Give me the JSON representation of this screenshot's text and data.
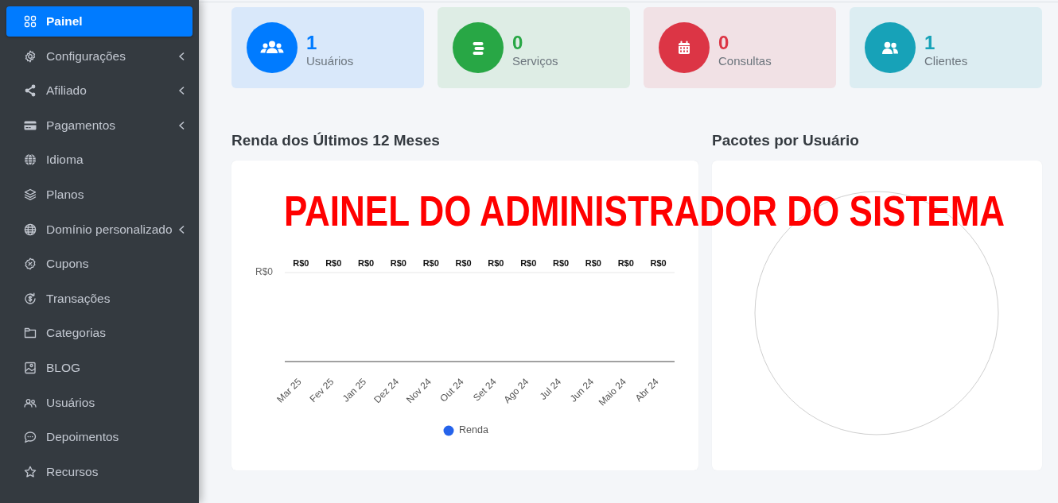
{
  "sidebar": {
    "items": [
      {
        "label": "Painel",
        "selected": true,
        "has_submenu": false
      },
      {
        "label": "Configurações",
        "selected": false,
        "has_submenu": true
      },
      {
        "label": "Afiliado",
        "selected": false,
        "has_submenu": true
      },
      {
        "label": "Pagamentos",
        "selected": false,
        "has_submenu": true
      },
      {
        "label": "Idioma",
        "selected": false,
        "has_submenu": false
      },
      {
        "label": "Planos",
        "selected": false,
        "has_submenu": false
      },
      {
        "label": "Domínio personalizado",
        "selected": false,
        "has_submenu": true
      },
      {
        "label": "Cupons",
        "selected": false,
        "has_submenu": false
      },
      {
        "label": "Transações",
        "selected": false,
        "has_submenu": false
      },
      {
        "label": "Categorias",
        "selected": false,
        "has_submenu": false
      },
      {
        "label": "BLOG",
        "selected": false,
        "has_submenu": false
      },
      {
        "label": "Usuários",
        "selected": false,
        "has_submenu": false
      },
      {
        "label": "Depoimentos",
        "selected": false,
        "has_submenu": false
      },
      {
        "label": "Recursos",
        "selected": false,
        "has_submenu": false
      }
    ]
  },
  "stat_cards": [
    {
      "value": "1",
      "label": "Usuários",
      "color": "#007bff"
    },
    {
      "value": "0",
      "label": "Serviços",
      "color": "#28a745"
    },
    {
      "value": "0",
      "label": "Consultas",
      "color": "#dc3545"
    },
    {
      "value": "1",
      "label": "Clientes",
      "color": "#17a2b8"
    }
  ],
  "revenue_panel": {
    "title": "Renda dos Últimos 12 Meses",
    "y_tick_label": "R$0",
    "value_labels": [
      "R$0",
      "R$0",
      "R$0",
      "R$0",
      "R$0",
      "R$0",
      "R$0",
      "R$0",
      "R$0",
      "R$0",
      "R$0",
      "R$0"
    ],
    "x_labels": [
      "Mar 25",
      "Fev 25",
      "Jan 25",
      "Dez 24",
      "Nov 24",
      "Out 24",
      "Set 24",
      "Ago 24",
      "Jul 24",
      "Jun 24",
      "Maio 24",
      "Abr 24"
    ],
    "legend": [
      {
        "label": "Renda",
        "color": "#2563eb"
      }
    ]
  },
  "packages_panel": {
    "title": "Pacotes por Usuário"
  },
  "overlay_caption": "PAINEL DO ADMINISTRADOR DO SISTEMA"
}
